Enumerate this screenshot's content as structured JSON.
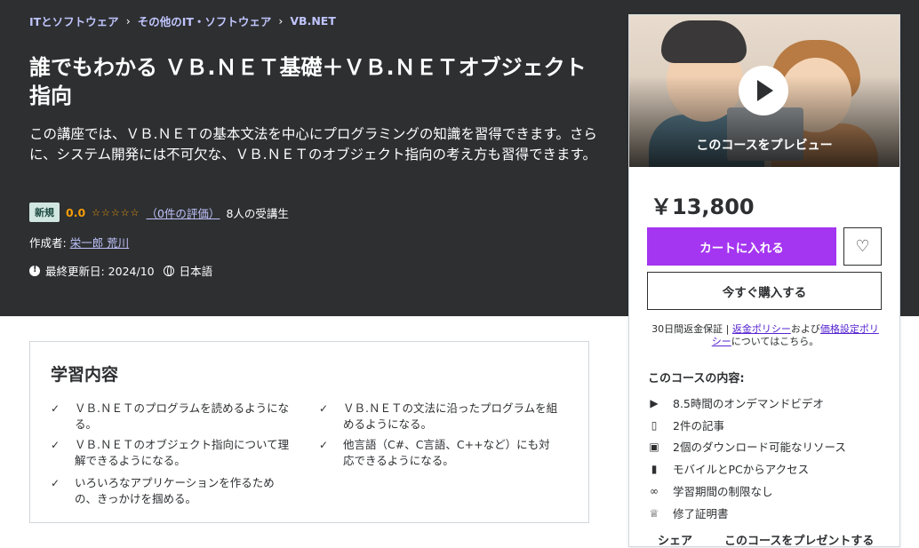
{
  "breadcrumb": [
    "ITとソフトウェア",
    "その他のIT・ソフトウェア",
    "VB.NET"
  ],
  "course": {
    "title": "誰でもわかる ＶＢ.ＮＥＴ基礎＋ＶＢ.ＮＥＴオブジェクト指向",
    "description": "この講座では、ＶＢ.ＮＥＴの基本文法を中心にプログラミングの知識を習得できます。さらに、システム開発には不可欠な、ＶＢ.ＮＥＴのオブジェクト指向の考え方も習得できます。",
    "badge": "新規",
    "rating": "0.0",
    "stars": "☆☆☆☆☆",
    "rating_count": "（0件の評価）",
    "students": "8人の受講生",
    "author_label": "作成者:",
    "author_name": "栄一郎 荒川",
    "last_updated": "最終更新日: 2024/10",
    "language": "日本語"
  },
  "learn": {
    "heading": "学習内容",
    "items": [
      "ＶＢ.ＮＥＴのプログラムを読めるようになる。",
      "ＶＢ.ＮＥＴの文法に沿ったプログラムを組めるようになる。",
      "ＶＢ.ＮＥＴのオブジェクト指向について理解できるようになる。",
      "他言語（C#、C言語、C++など）にも対応できるようになる。",
      "いろいろなアプリケーションを作るための、きっかけを掴める。"
    ]
  },
  "sidebar": {
    "preview_label": "このコースをプレビュー",
    "price": "￥13,800",
    "cart_button": "カートに入れる",
    "buy_button": "今すぐ購入する",
    "guarantee_text": "30日間返金保証",
    "guarantee_sep": " | ",
    "refund_link": "返金ポリシー",
    "and_text": "および",
    "pricing_link": "価格設定ポリシー",
    "tail_text": "についてはこちら。",
    "includes_title": "このコースの内容:",
    "includes": [
      {
        "icon": "video-icon",
        "glyph": "▶",
        "text": "8.5時間のオンデマンドビデオ"
      },
      {
        "icon": "file-icon",
        "glyph": "▯",
        "text": "2件の記事"
      },
      {
        "icon": "folder-download-icon",
        "glyph": "▣",
        "text": "2個のダウンロード可能なリソース"
      },
      {
        "icon": "mobile-icon",
        "glyph": "▮",
        "text": "モバイルとPCからアクセス"
      },
      {
        "icon": "infinity-icon",
        "glyph": "∞",
        "text": "学習期間の制限なし"
      },
      {
        "icon": "trophy-icon",
        "glyph": "♕",
        "text": "修了証明書"
      }
    ],
    "share": "シェア",
    "gift": "このコースをプレゼントする"
  },
  "colors": {
    "hero_bg": "#2d2f31",
    "accent": "#a435f0",
    "link": "#c0c4fc",
    "star": "#f69c08"
  }
}
